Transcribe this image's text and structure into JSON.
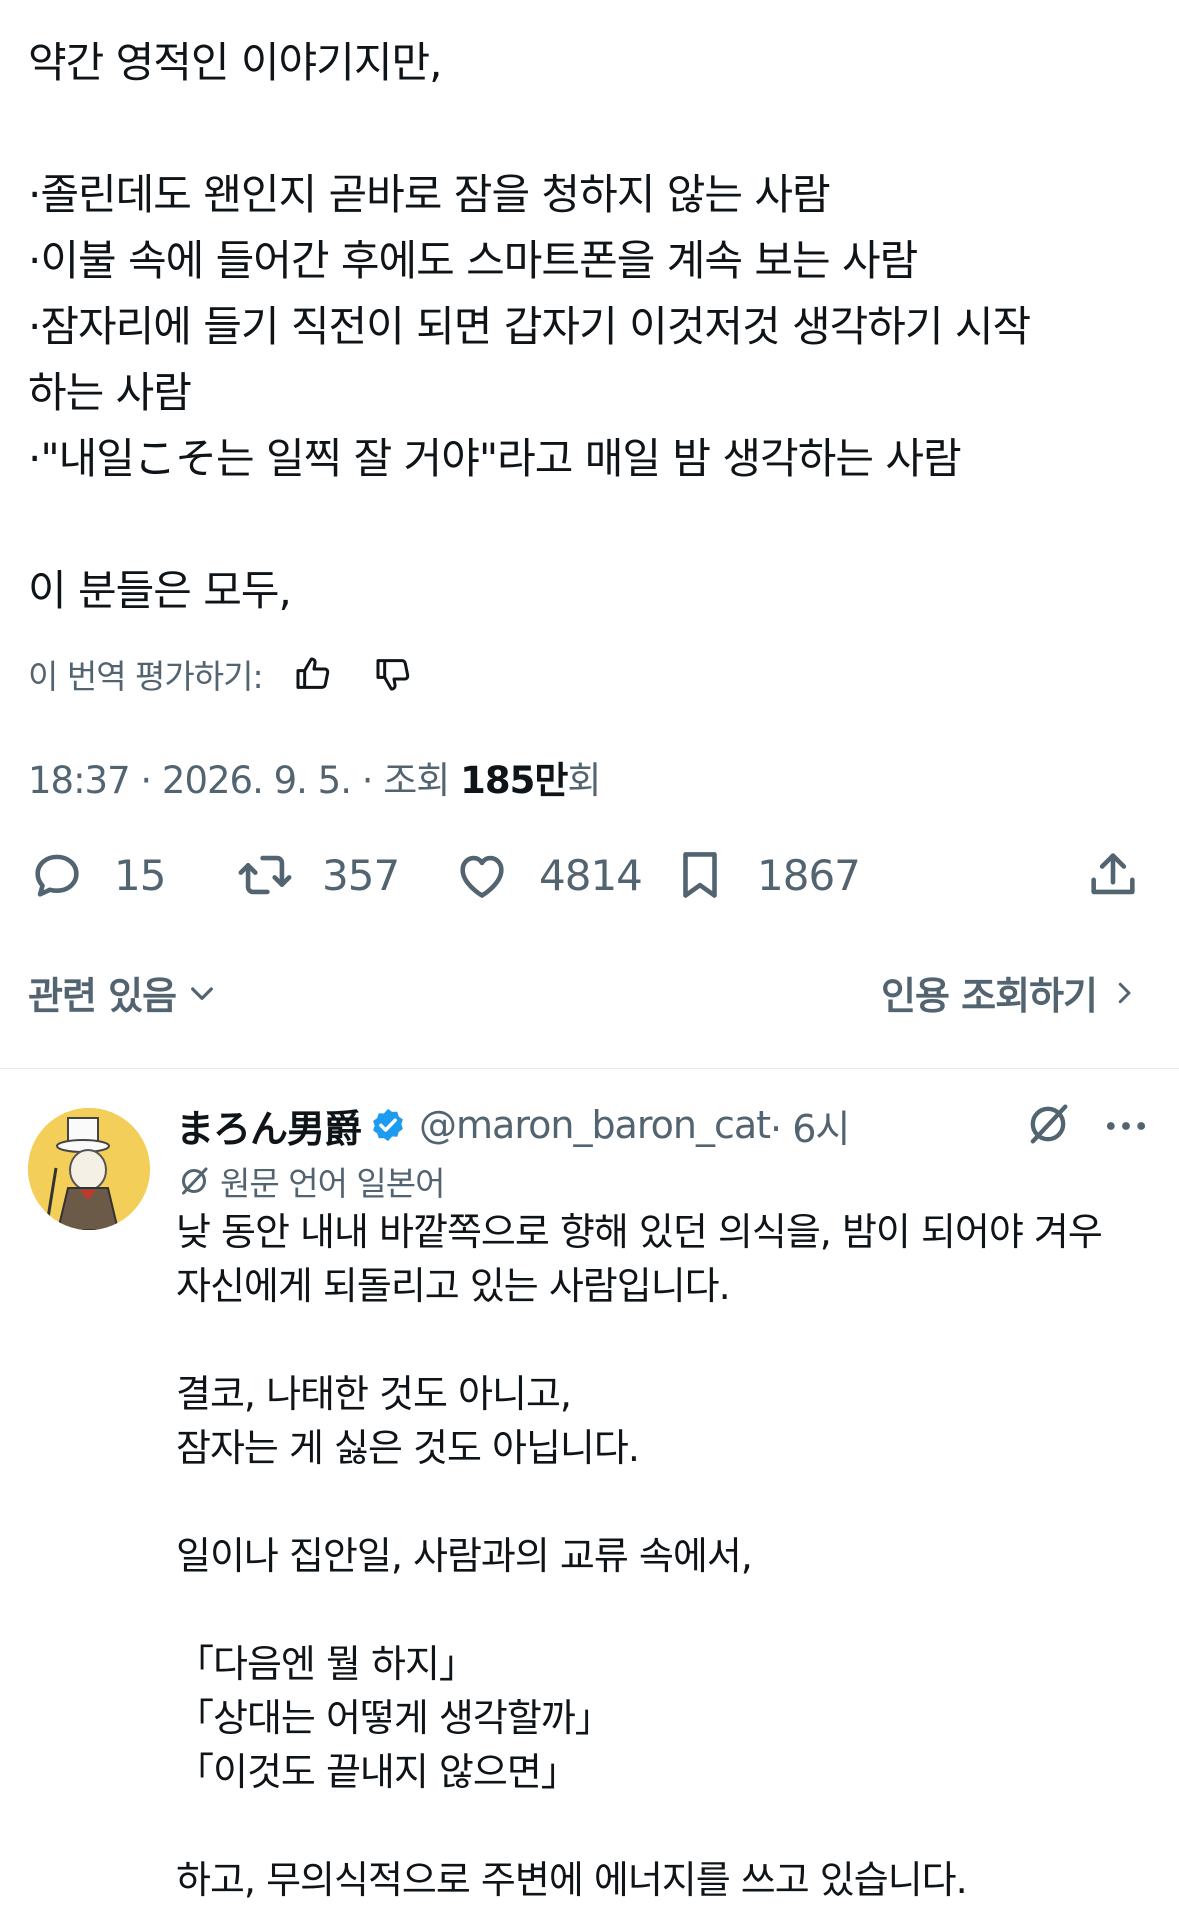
{
  "tweet": {
    "lines": [
      "약간 영적인 이야기지만,",
      "",
      "·졸린데도 왠인지 곧바로 잠을 청하지 않는 사람",
      "·이불 속에 들어간 후에도 스마트폰을 계속 보는 사람",
      "·잠자리에 들기 직전이 되면 갑자기 이것저것 생각하기 시작",
      "하는 사람",
      "·\"내일こそ는 일찍 잘 거야\"라고 매일 밤 생각하는 사람",
      "",
      "이 분들은 모두,"
    ],
    "rate_label": "이 번역 평가하기:",
    "meta_prefix": "18:37 · 2026. 9. 5. · 조회 ",
    "views": "185만",
    "views_suffix": "회",
    "actions": {
      "replies": "15",
      "retweets": "357",
      "likes": "4814",
      "bookmarks": "1867"
    },
    "related_label": "관련 있음",
    "quotes_label": "인용 조회하기"
  },
  "reply": {
    "name": "まろん男爵",
    "handle": "@maron_baron_cat",
    "time": "· 6시",
    "original_language": "원문 언어 일본어",
    "lines": [
      "낮 동안 내내 바깥쪽으로 향해 있던 의식을, 밤이 되어야 겨우",
      "자신에게 되돌리고 있는 사람입니다.",
      "",
      "결코, 나태한 것도 아니고,",
      "잠자는 게 싫은 것도 아닙니다.",
      "",
      "일이나 집안일, 사람과의 교류 속에서,",
      "",
      "「다음엔 뭘 하지」",
      "「상대는 어떻게 생각할까」",
      "「이것도 끝내지 않으면」",
      "",
      "하고, 무의식적으로 주변에 에너지를 쓰고 있습니다."
    ]
  },
  "colors": {
    "text": "#0f1419",
    "secondary": "#536471",
    "verified": "#1d9bf0",
    "divider": "#e6e9ec",
    "avatar_bg": "#f3cf5a"
  },
  "icons": [
    "thumbs-up-icon",
    "thumbs-down-icon",
    "reply-icon",
    "retweet-icon",
    "like-icon",
    "bookmark-icon",
    "share-icon",
    "chevron-down-icon",
    "chevron-right-icon",
    "verified-icon",
    "grok-icon",
    "more-icon",
    "translate-icon"
  ]
}
